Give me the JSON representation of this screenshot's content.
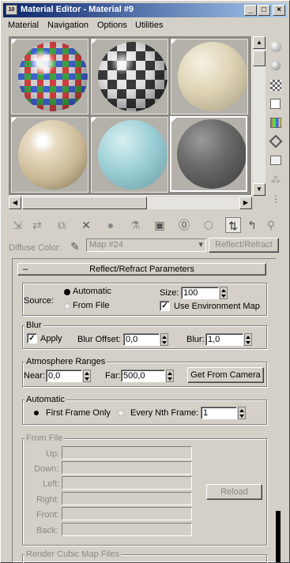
{
  "window": {
    "title": "Material Editor - Material #9",
    "app_icon": "3ds-max-icon"
  },
  "menu": [
    "Material",
    "Navigation",
    "Options",
    "Utilities"
  ],
  "title_buttons": [
    "minimize-icon",
    "maximize-icon",
    "close-icon"
  ],
  "slots": [
    {
      "name": "glass-sphere",
      "active": false
    },
    {
      "name": "checker-sphere",
      "active": false
    },
    {
      "name": "cream-sphere",
      "active": false
    },
    {
      "name": "stucco-sphere",
      "active": false
    },
    {
      "name": "cyan-sphere",
      "active": false
    },
    {
      "name": "dark-sphere",
      "active": true
    }
  ],
  "toolbar": {
    "diffuse_label": "Diffuse Color:",
    "map_value": "Map #24",
    "map_type_button": "Reflect/Refract"
  },
  "rollout": {
    "title": "Reflect/Refract Parameters",
    "collapse_glyph": "–"
  },
  "source": {
    "label": "Source:",
    "option_automatic": "Automatic",
    "option_from_file": "From File",
    "selected": "Automatic",
    "size_label": "Size:",
    "size_value": "100",
    "use_env_label": "Use Environment Map",
    "use_env_checked": true
  },
  "blur": {
    "title": "Blur",
    "apply_label": "Apply",
    "apply_checked": true,
    "offset_label": "Blur Offset:",
    "offset_value": "0,0",
    "blur_label": "Blur:",
    "blur_value": "1,0"
  },
  "atmosphere": {
    "title": "Atmosphere Ranges",
    "near_label": "Near:",
    "near_value": "0,0",
    "far_label": "Far:",
    "far_value": "500,0",
    "get_camera_button": "Get From Camera"
  },
  "automatic": {
    "title": "Automatic",
    "first_frame_label": "First Frame Only",
    "nth_frame_label": "Every Nth Frame:",
    "nth_value": "1",
    "selected": "First Frame Only"
  },
  "from_file": {
    "title": "From File",
    "labels": [
      "Up:",
      "Down:",
      "Left:",
      "Right:",
      "Front:",
      "Back:"
    ],
    "reload_button": "Reload"
  },
  "render_cubic": {
    "title": "Render Cubic Map Files"
  },
  "colors": {
    "title_start": "#0a246a",
    "title_end": "#a6caf0",
    "face": "#d4d0c8",
    "disabled": "#8a8884"
  }
}
